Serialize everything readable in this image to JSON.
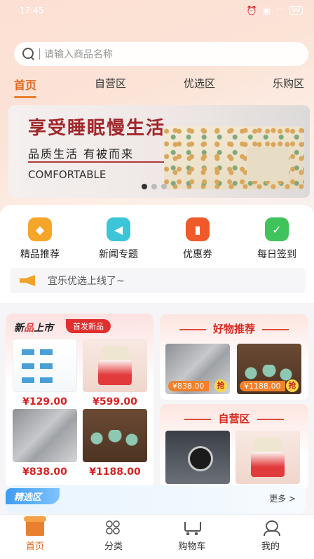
{
  "status_bar": {
    "time": "17:45",
    "battery": "99"
  },
  "search": {
    "placeholder": "请输入商品名称"
  },
  "top_tabs": [
    {
      "label": "首页",
      "active": true
    },
    {
      "label": "自营区",
      "active": false
    },
    {
      "label": "优选区",
      "active": false
    },
    {
      "label": "乐购区",
      "active": false
    }
  ],
  "banner": {
    "title": "享受睡眠慢生活",
    "subtitle": "品质生活 有被而来",
    "english": "COMFORTABLE",
    "page_count": 3,
    "current_page": 1
  },
  "quick_entries": [
    {
      "label": "精品推荐",
      "icon": "diamond-icon",
      "color": "#f4a62a",
      "glyph": "◆"
    },
    {
      "label": "新闻专题",
      "icon": "speaker-icon",
      "color": "#3cc4d8",
      "glyph": "◀"
    },
    {
      "label": "优惠券",
      "icon": "coupon-icon",
      "color": "#f05a2a",
      "glyph": "▮"
    },
    {
      "label": "每日签到",
      "icon": "calendar-check-icon",
      "color": "#3fc35a",
      "glyph": "✓"
    }
  ],
  "notice": {
    "text": "宜乐优选上线了~"
  },
  "new_arrivals": {
    "title_prefix": "新",
    "title_highlight": "品",
    "title_suffix": "上市",
    "tag": "首发新品",
    "products": [
      {
        "price": "¥129.00"
      },
      {
        "price": "¥599.00"
      },
      {
        "price": "¥838.00"
      },
      {
        "price": "¥1188.00"
      }
    ]
  },
  "good_picks": {
    "title": "好物推荐",
    "products": [
      {
        "price": "¥838.00",
        "badge": "抢"
      },
      {
        "price": "¥1188.00",
        "badge": "抢"
      }
    ]
  },
  "self_run": {
    "title": "自营区"
  },
  "featured": {
    "title": "精选区",
    "more": "更多 >"
  },
  "bottom_nav": [
    {
      "label": "首页",
      "icon": "home-icon",
      "active": true
    },
    {
      "label": "分类",
      "icon": "grid-icon",
      "active": false
    },
    {
      "label": "购物车",
      "icon": "cart-icon",
      "active": false
    },
    {
      "label": "我的",
      "icon": "user-icon",
      "active": false
    }
  ]
}
